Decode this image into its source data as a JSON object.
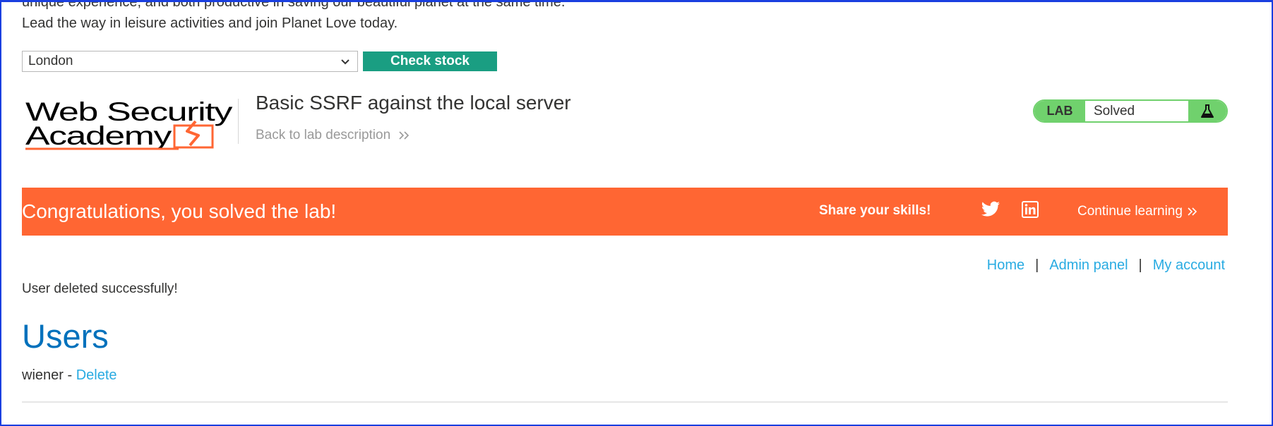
{
  "product": {
    "cut_text": "unique experience, and both productive in saving our beautiful planet at the same time.",
    "description": "Lead the way in leisure activities and join Planet Love today."
  },
  "stock": {
    "selected_store": "London",
    "check_label": "Check stock"
  },
  "header": {
    "logo_line1": "Web Security",
    "logo_line2": "Academy",
    "lab_title": "Basic SSRF against the local server",
    "back_link": "Back to lab description",
    "badge_label": "LAB",
    "badge_status": "Solved"
  },
  "banner": {
    "message": "Congratulations, you solved the lab!",
    "share_label": "Share your skills!",
    "continue_label": "Continue learning",
    "color": "#ff6633"
  },
  "nav": {
    "home": "Home",
    "admin": "Admin panel",
    "account": "My account",
    "separator": "|"
  },
  "page": {
    "status_message": "User deleted successfully!",
    "heading": "Users",
    "users": [
      {
        "name": "wiener",
        "separator": "-",
        "action": "Delete"
      }
    ]
  },
  "colors": {
    "accent_green": "#70d16d",
    "button_teal": "#1a9e82",
    "link_blue": "#29abe2",
    "heading_blue": "#0071bc",
    "logo_orange": "#ff6633"
  },
  "icons": {
    "dropdown": "chevron-down-icon",
    "back": "double-chevron-right-icon",
    "badge": "flask-icon",
    "share_twitter": "twitter-icon",
    "share_linkedin": "linkedin-icon"
  }
}
